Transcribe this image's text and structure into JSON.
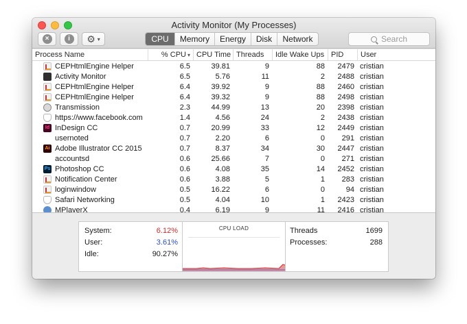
{
  "window": {
    "title": "Activity Monitor (My Processes)"
  },
  "toolbar": {
    "stop_icon": "close-x-icon",
    "info_icon": "info-icon",
    "gear_icon": "gear-icon",
    "tabs": [
      "CPU",
      "Memory",
      "Energy",
      "Disk",
      "Network"
    ],
    "active_tab": "CPU",
    "search_placeholder": "Search"
  },
  "table": {
    "columns": [
      "Process Name",
      "% CPU",
      "CPU Time",
      "Threads",
      "Idle Wake Ups",
      "PID",
      "User"
    ],
    "sort_column": "% CPU",
    "rows": [
      {
        "name": "CEPHtmlEngine Helper",
        "icon": "engine",
        "cpu": "6.5",
        "time": "39.81",
        "threads": "9",
        "idle": "88",
        "pid": "2479",
        "user": "cristian"
      },
      {
        "name": "Activity Monitor",
        "icon": "monitor",
        "cpu": "6.5",
        "time": "5.76",
        "threads": "11",
        "idle": "2",
        "pid": "2488",
        "user": "cristian"
      },
      {
        "name": "CEPHtmlEngine Helper",
        "icon": "engine",
        "cpu": "6.4",
        "time": "39.92",
        "threads": "9",
        "idle": "88",
        "pid": "2460",
        "user": "cristian"
      },
      {
        "name": "CEPHtmlEngine Helper",
        "icon": "engine",
        "cpu": "6.4",
        "time": "39.32",
        "threads": "9",
        "idle": "88",
        "pid": "2498",
        "user": "cristian"
      },
      {
        "name": "Transmission",
        "icon": "transmission",
        "cpu": "2.3",
        "time": "44.99",
        "threads": "13",
        "idle": "20",
        "pid": "2398",
        "user": "cristian"
      },
      {
        "name": "https://www.facebook.com",
        "icon": "shield",
        "cpu": "1.4",
        "time": "4.56",
        "threads": "24",
        "idle": "2",
        "pid": "2438",
        "user": "cristian"
      },
      {
        "name": "InDesign CC",
        "icon": "indesign",
        "cpu": "0.7",
        "time": "20.99",
        "threads": "33",
        "idle": "12",
        "pid": "2449",
        "user": "cristian"
      },
      {
        "name": "usernoted",
        "icon": "blank",
        "cpu": "0.7",
        "time": "2.20",
        "threads": "6",
        "idle": "0",
        "pid": "291",
        "user": "cristian"
      },
      {
        "name": "Adobe Illustrator CC 2015",
        "icon": "illustrator",
        "cpu": "0.7",
        "time": "8.37",
        "threads": "34",
        "idle": "30",
        "pid": "2447",
        "user": "cristian"
      },
      {
        "name": "accountsd",
        "icon": "blank",
        "cpu": "0.6",
        "time": "25.66",
        "threads": "7",
        "idle": "0",
        "pid": "271",
        "user": "cristian"
      },
      {
        "name": "Photoshop CC",
        "icon": "photoshop",
        "cpu": "0.6",
        "time": "4.08",
        "threads": "35",
        "idle": "14",
        "pid": "2452",
        "user": "cristian"
      },
      {
        "name": "Notification Center",
        "icon": "engine",
        "cpu": "0.6",
        "time": "3.88",
        "threads": "5",
        "idle": "1",
        "pid": "283",
        "user": "cristian"
      },
      {
        "name": "loginwindow",
        "icon": "engine",
        "cpu": "0.5",
        "time": "16.22",
        "threads": "6",
        "idle": "0",
        "pid": "94",
        "user": "cristian"
      },
      {
        "name": "Safari Networking",
        "icon": "shield",
        "cpu": "0.5",
        "time": "4.04",
        "threads": "10",
        "idle": "1",
        "pid": "2423",
        "user": "cristian"
      },
      {
        "name": "MPlayerX",
        "icon": "mplayer",
        "cpu": "0.4",
        "time": "6.19",
        "threads": "9",
        "idle": "11",
        "pid": "2416",
        "user": "cristian"
      }
    ]
  },
  "stats": {
    "system_label": "System:",
    "system_value": "6.12%",
    "user_label": "User:",
    "user_value": "3.61%",
    "idle_label": "Idle:",
    "idle_value": "90.27%",
    "load_title": "CPU LOAD",
    "threads_label": "Threads",
    "threads_value": "1699",
    "processes_label": "Processes:",
    "processes_value": "288"
  },
  "colors": {
    "system": "#d52a2a",
    "user": "#2c4fd8"
  }
}
